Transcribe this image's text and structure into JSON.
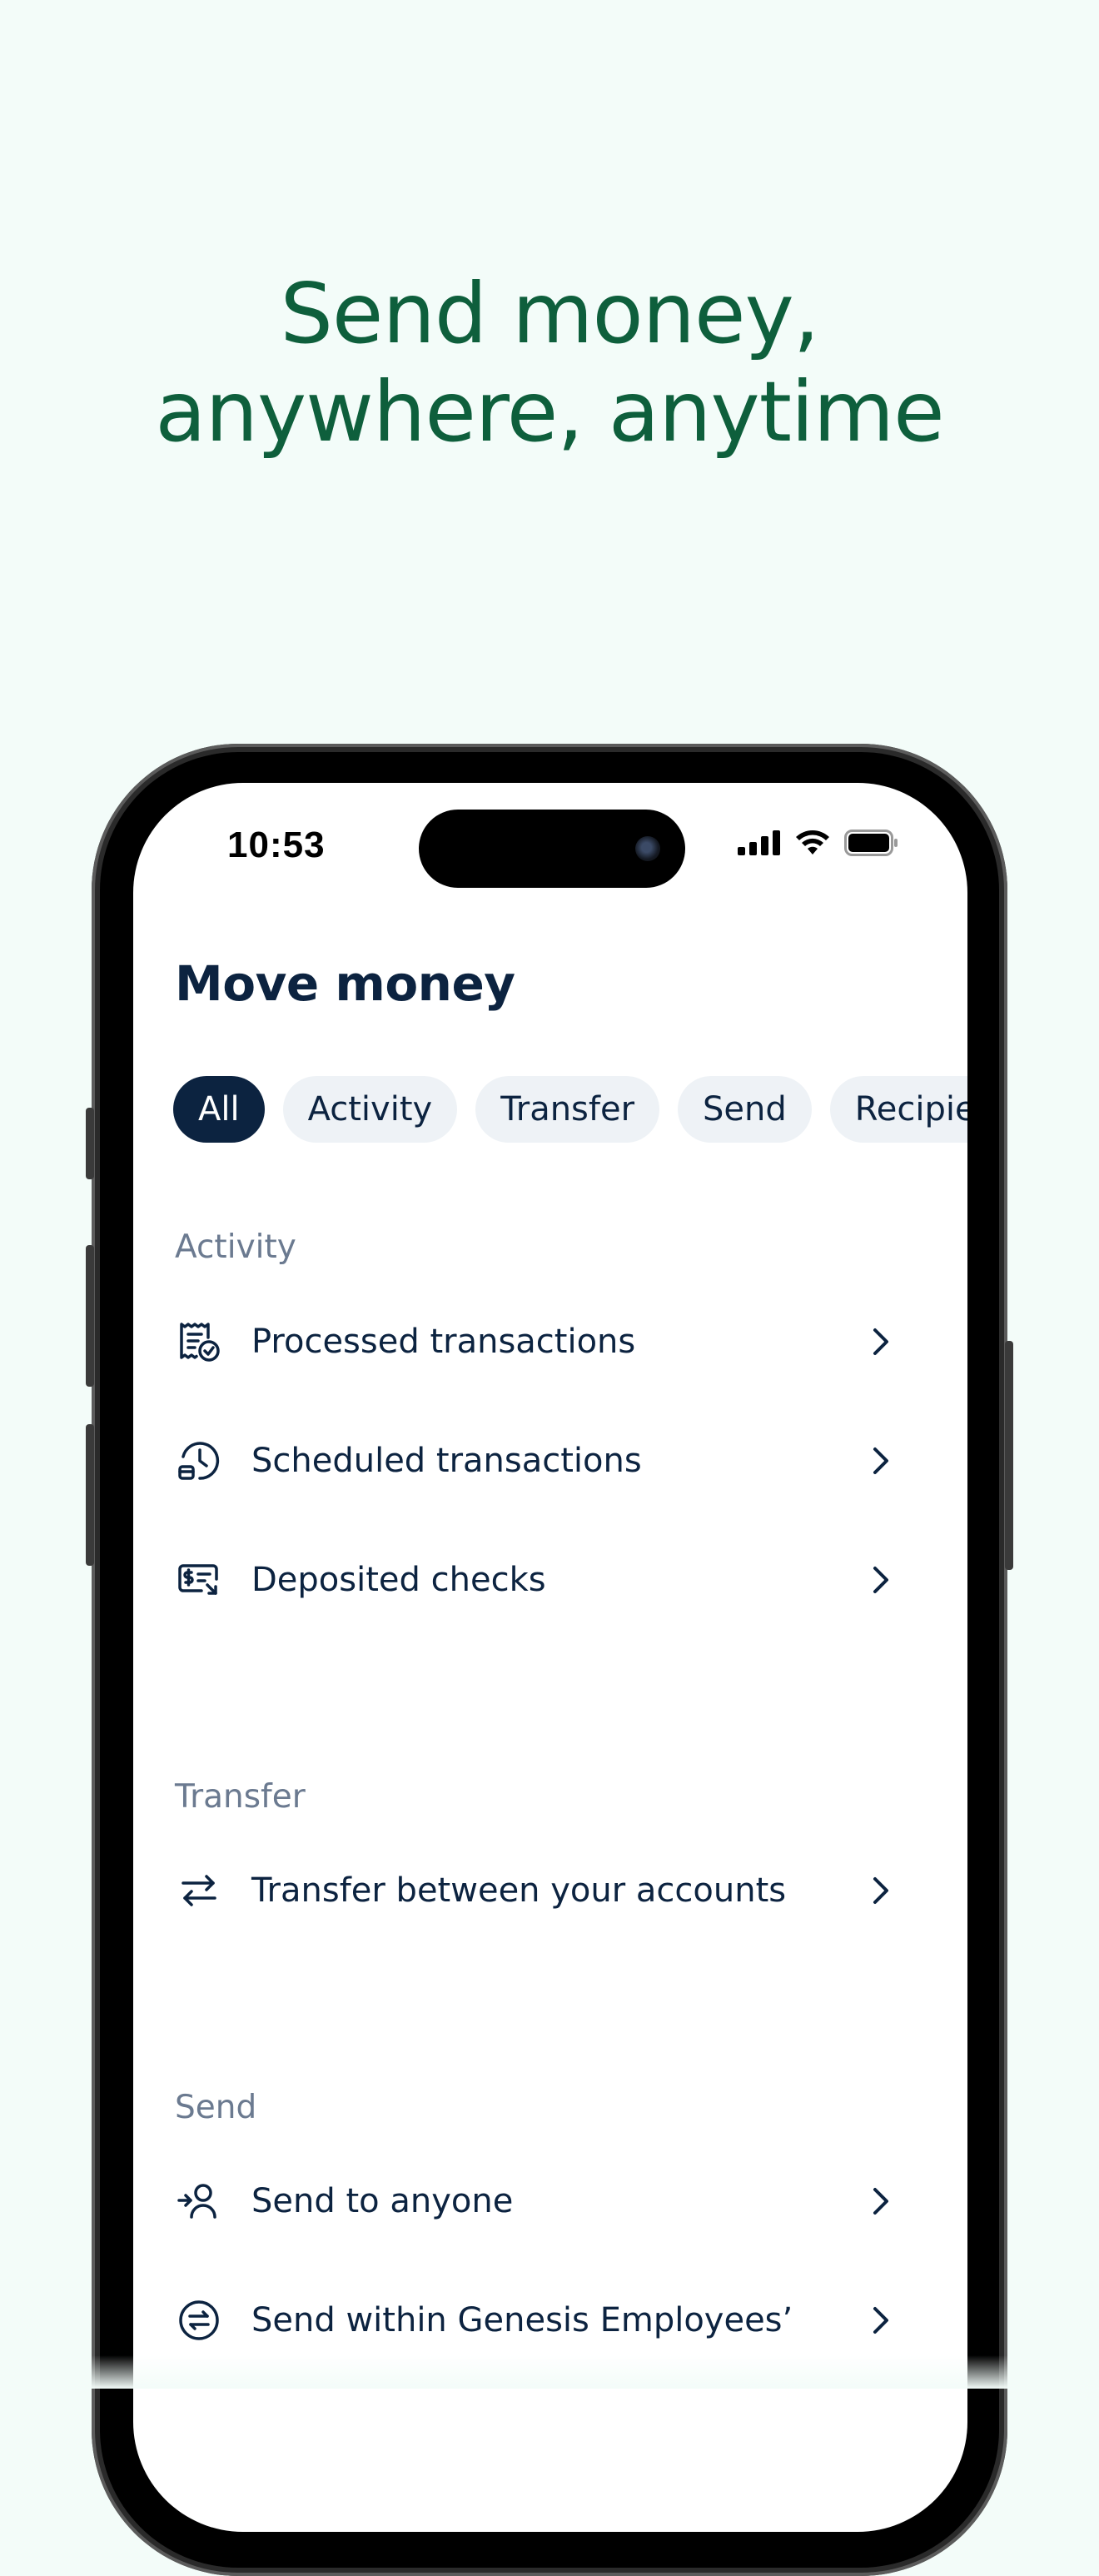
{
  "headline": {
    "line1": "Send money,",
    "line2": "anywhere, anytime"
  },
  "status_bar": {
    "time": "10:53",
    "icons": [
      "cellular-signal-icon",
      "wifi-icon",
      "battery-icon"
    ]
  },
  "screen": {
    "title": "Move money",
    "filters": [
      {
        "label": "All",
        "selected": true
      },
      {
        "label": "Activity",
        "selected": false
      },
      {
        "label": "Transfer",
        "selected": false
      },
      {
        "label": "Send",
        "selected": false
      },
      {
        "label": "Recipien",
        "selected": false
      }
    ],
    "sections": {
      "activity": {
        "label": "Activity",
        "items": [
          {
            "label": "Processed transactions",
            "icon": "receipt-check-icon"
          },
          {
            "label": "Scheduled transactions",
            "icon": "clock-history-icon"
          },
          {
            "label": "Deposited checks",
            "icon": "check-deposit-icon"
          }
        ]
      },
      "transfer": {
        "label": "Transfer",
        "items": [
          {
            "label": "Transfer between your accounts",
            "icon": "transfer-arrows-icon"
          }
        ]
      },
      "send": {
        "label": "Send",
        "items": [
          {
            "label": "Send to anyone",
            "icon": "send-to-person-icon"
          },
          {
            "label": "Send within Genesis Employees’",
            "icon": "exchange-circle-icon"
          }
        ]
      }
    }
  },
  "colors": {
    "background": "#F3FCF9",
    "headline": "#0E5F3C",
    "primary_text": "#0C2340",
    "secondary_text": "#6B7A90",
    "chip_bg": "#EEF2F6",
    "chip_active_bg": "#0C2340"
  }
}
